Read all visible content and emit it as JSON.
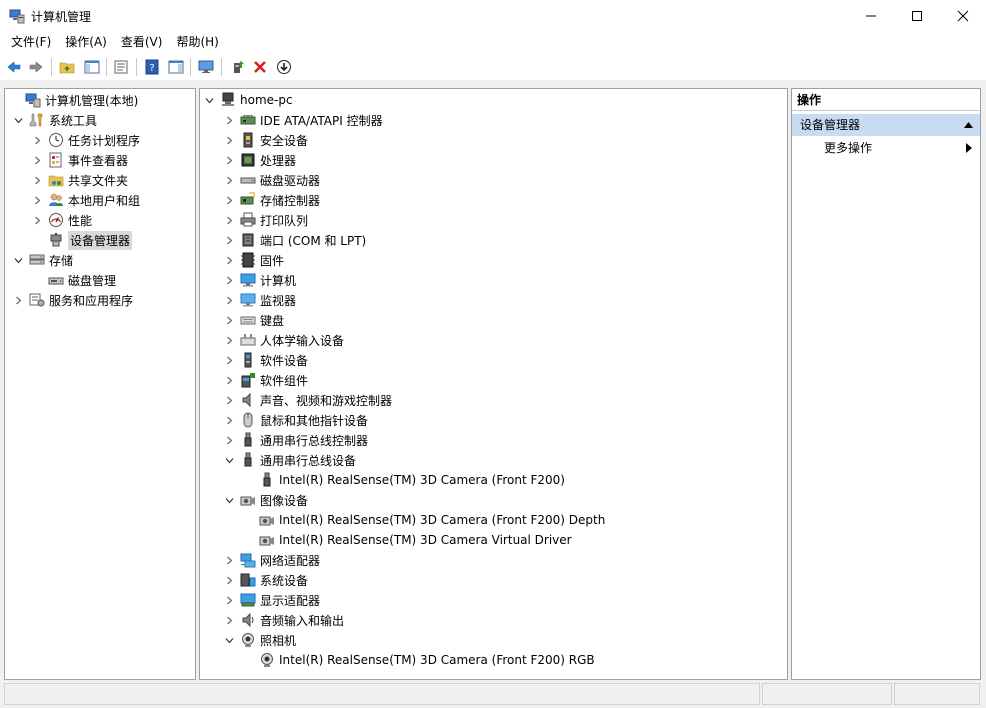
{
  "window": {
    "title": "计算机管理",
    "minimize_label": "minimize",
    "maximize_label": "maximize",
    "close_label": "close"
  },
  "menu": [
    "文件(F)",
    "操作(A)",
    "查看(V)",
    "帮助(H)"
  ],
  "left_tree": {
    "root": "计算机管理(本地)",
    "items": [
      {
        "label": "系统工具",
        "level": 1,
        "expanded": true,
        "icon": "tools-icon"
      },
      {
        "label": "任务计划程序",
        "level": 2,
        "expanded": false,
        "icon": "clock-icon"
      },
      {
        "label": "事件查看器",
        "level": 2,
        "expanded": false,
        "icon": "event-viewer-icon"
      },
      {
        "label": "共享文件夹",
        "level": 2,
        "expanded": false,
        "icon": "shared-folder-icon"
      },
      {
        "label": "本地用户和组",
        "level": 2,
        "expanded": false,
        "icon": "users-icon"
      },
      {
        "label": "性能",
        "level": 2,
        "expanded": false,
        "icon": "performance-icon"
      },
      {
        "label": "设备管理器",
        "level": 2,
        "selected": true,
        "icon": "device-manager-icon"
      },
      {
        "label": "存储",
        "level": 1,
        "expanded": true,
        "icon": "storage-icon"
      },
      {
        "label": "磁盘管理",
        "level": 2,
        "icon": "disk-management-icon"
      },
      {
        "label": "服务和应用程序",
        "level": 1,
        "expanded": false,
        "icon": "services-icon"
      }
    ]
  },
  "device_tree": {
    "root": "home-pc",
    "items": [
      {
        "label": "IDE ATA/ATAPI 控制器",
        "level": 1,
        "expanded": false,
        "icon": "ide-controller-icon"
      },
      {
        "label": "安全设备",
        "level": 1,
        "expanded": false,
        "icon": "security-device-icon"
      },
      {
        "label": "处理器",
        "level": 1,
        "expanded": false,
        "icon": "processor-icon"
      },
      {
        "label": "磁盘驱动器",
        "level": 1,
        "expanded": false,
        "icon": "disk-drive-icon"
      },
      {
        "label": "存储控制器",
        "level": 1,
        "expanded": false,
        "icon": "storage-controller-icon"
      },
      {
        "label": "打印队列",
        "level": 1,
        "expanded": false,
        "icon": "printer-icon"
      },
      {
        "label": "端口 (COM 和 LPT)",
        "level": 1,
        "expanded": false,
        "icon": "port-icon"
      },
      {
        "label": "固件",
        "level": 1,
        "expanded": false,
        "icon": "firmware-icon"
      },
      {
        "label": "计算机",
        "level": 1,
        "expanded": false,
        "icon": "computer-icon"
      },
      {
        "label": "监视器",
        "level": 1,
        "expanded": false,
        "icon": "monitor-icon"
      },
      {
        "label": "键盘",
        "level": 1,
        "expanded": false,
        "icon": "keyboard-icon"
      },
      {
        "label": "人体学输入设备",
        "level": 1,
        "expanded": false,
        "icon": "hid-icon"
      },
      {
        "label": "软件设备",
        "level": 1,
        "expanded": false,
        "icon": "software-device-icon"
      },
      {
        "label": "软件组件",
        "level": 1,
        "expanded": false,
        "icon": "software-component-icon"
      },
      {
        "label": "声音、视频和游戏控制器",
        "level": 1,
        "expanded": false,
        "icon": "sound-icon"
      },
      {
        "label": "鼠标和其他指针设备",
        "level": 1,
        "expanded": false,
        "icon": "mouse-icon"
      },
      {
        "label": "通用串行总线控制器",
        "level": 1,
        "expanded": false,
        "icon": "usb-icon"
      },
      {
        "label": "通用串行总线设备",
        "level": 1,
        "expanded": true,
        "icon": "usb-icon"
      },
      {
        "label": "Intel(R) RealSense(TM) 3D Camera (Front F200)",
        "level": 2,
        "icon": "usb-icon"
      },
      {
        "label": "图像设备",
        "level": 1,
        "expanded": true,
        "icon": "imaging-device-icon"
      },
      {
        "label": "Intel(R) RealSense(TM) 3D Camera (Front F200) Depth",
        "level": 2,
        "icon": "imaging-device-icon"
      },
      {
        "label": "Intel(R) RealSense(TM) 3D Camera Virtual Driver",
        "level": 2,
        "icon": "imaging-device-icon"
      },
      {
        "label": "网络适配器",
        "level": 1,
        "expanded": false,
        "icon": "network-adapter-icon"
      },
      {
        "label": "系统设备",
        "level": 1,
        "expanded": false,
        "icon": "system-device-icon"
      },
      {
        "label": "显示适配器",
        "level": 1,
        "expanded": false,
        "icon": "display-adapter-icon"
      },
      {
        "label": "音频输入和输出",
        "level": 1,
        "expanded": false,
        "icon": "audio-icon"
      },
      {
        "label": "照相机",
        "level": 1,
        "expanded": true,
        "icon": "camera-icon"
      },
      {
        "label": "Intel(R) RealSense(TM) 3D Camera (Front F200) RGB",
        "level": 2,
        "icon": "camera-icon"
      }
    ]
  },
  "actions": {
    "header": "操作",
    "section": "设备管理器",
    "item": "更多操作"
  }
}
